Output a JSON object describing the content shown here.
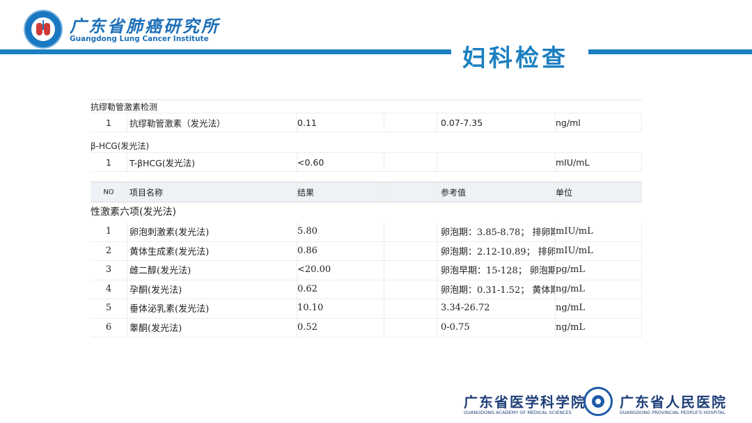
{
  "header": {
    "org_cn": "广东省肺癌研究所",
    "org_en": "Guangdong Lung Cancer Institute",
    "title": "妇科检查"
  },
  "amh": {
    "section": "抗缪勒管激素检测",
    "row": {
      "no": "1",
      "name": "抗缪勒管激素（发光法）",
      "value": "0.11",
      "ref": "0.07-7.35",
      "unit": "ng/ml"
    }
  },
  "hcg": {
    "section": "β-HCG(发光法)",
    "row": {
      "no": "1",
      "name": "T-βHCG(发光法)",
      "value": "<0.60",
      "ref": "",
      "unit": "mIU/mL"
    }
  },
  "table": {
    "headers": {
      "no": "NO",
      "name": "项目名称",
      "value": "结果",
      "ref": "参考值",
      "unit": "单位"
    },
    "section": "性激素六项(发光法)",
    "rows": [
      {
        "no": "1",
        "name": "卵泡刺激素(发光法)",
        "value": "5.80",
        "ref": "卵泡期：3.85-8.78； 排卵期",
        "unit": "mIU/mL"
      },
      {
        "no": "2",
        "name": "黄体生成素(发光法)",
        "value": "0.86",
        "ref": "卵泡期：2.12-10.89； 排卵",
        "unit": "mIU/mL"
      },
      {
        "no": "3",
        "name": "雌二醇(发光法)",
        "value": "<20.00",
        "ref": "卵泡早期：15-128； 卵泡期",
        "unit": "pg/mL"
      },
      {
        "no": "4",
        "name": "孕酮(发光法)",
        "value": "0.62",
        "ref": "卵泡期：0.31-1.52； 黄体期",
        "unit": "ng/mL"
      },
      {
        "no": "5",
        "name": "垂体泌乳素(发光法)",
        "value": "10.10",
        "ref": "3.34-26.72",
        "unit": "ng/mL"
      },
      {
        "no": "6",
        "name": "睾酮(发光法)",
        "value": "0.52",
        "ref": "0-0.75",
        "unit": "ng/mL"
      }
    ]
  },
  "footer": {
    "academy_cn": "广东省医学科学院",
    "academy_en": "GUANGDONG ACADEMY OF MEDICAL SCIENCES",
    "hospital_cn": "广东省人民医院",
    "hospital_en": "GUANGDONG PROVINCIAL PEOPLE'S HOSPITAL"
  }
}
